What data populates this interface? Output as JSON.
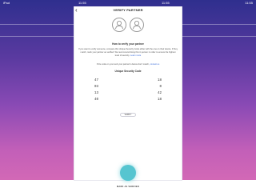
{
  "statusbar": {
    "left": "iPad",
    "center_left": "11:55",
    "center_right": "11:55",
    "right": "11:55"
  },
  "header": {
    "title": "VERIFY PARTNER",
    "back_icon": "chevron-left-icon"
  },
  "avatars": [
    "user-icon",
    "user-icon"
  ],
  "how_to": {
    "heading": "How to verify your partner",
    "body": "If you want to verify someone, compare this Unique Security Code either with the one on their device. If they match, mark your partner as verified. We recommend doing this in person in order to ensure the highest level of security.",
    "link": "Learn more",
    "secondary": "If the code on your and your partner's device don't match,",
    "secondary_link": "contact us"
  },
  "security_code": {
    "heading": "Unique Security Code",
    "rows": [
      {
        "left": "47",
        "right": "18"
      },
      {
        "left": "03",
        "right": "0"
      },
      {
        "left": "13",
        "right": "42"
      },
      {
        "left": "40",
        "right": "18"
      }
    ]
  },
  "verify_button": "VERIFY",
  "bottom": {
    "label": "MARK AS VERIFIED"
  },
  "colors": {
    "gradient_top": "#2f2f8e",
    "gradient_bottom": "#d96cb5",
    "accent": "#56c5d0",
    "link": "#3a6bd8"
  }
}
